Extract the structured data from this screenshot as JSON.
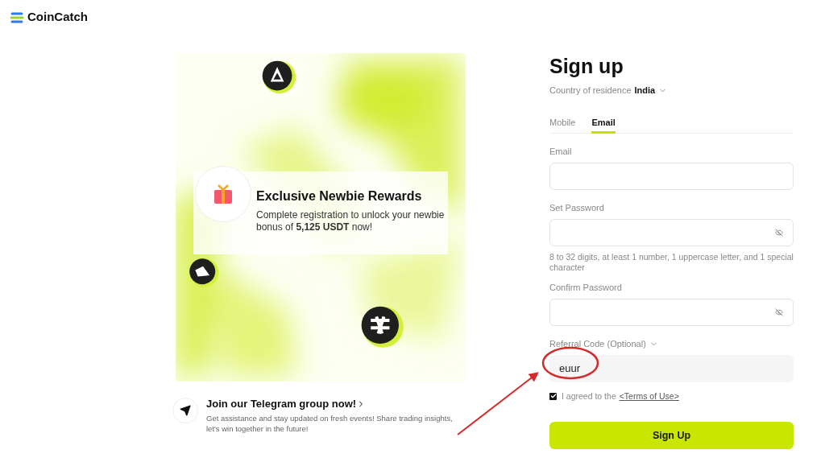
{
  "logo": {
    "text": "CoinCatch"
  },
  "promo": {
    "title": "Exclusive Newbie Rewards",
    "text": "Complete registration to unlock your newbie bonus of **5,125 USDT** now!"
  },
  "telegram": {
    "title": "Join our Telegram group now!",
    "text": "Get assistance and stay updated on fresh events! Share trading insights, let's win together in the future!"
  },
  "signup": {
    "title": "Sign up",
    "country_label": "Country of residence",
    "country_value": "India",
    "tabs": [
      {
        "label": "Mobile",
        "selected": false
      },
      {
        "label": "Email",
        "selected": true
      }
    ],
    "fields": [
      {
        "kind": "text",
        "label": "Email"
      },
      {
        "kind": "password",
        "label": "Set Password",
        "hint": "8 to 32 digits, at least 1 number, 1 uppercase letter, and 1 special character"
      },
      {
        "kind": "password",
        "label": "Confirm Password"
      },
      {
        "kind": "referral",
        "label": "Referral Code (Optional)",
        "value": "euur"
      }
    ],
    "agreement": {
      "checked": true,
      "text": "I agreed to the",
      "link": "<Terms of Use>"
    },
    "button": "Sign Up"
  }
}
